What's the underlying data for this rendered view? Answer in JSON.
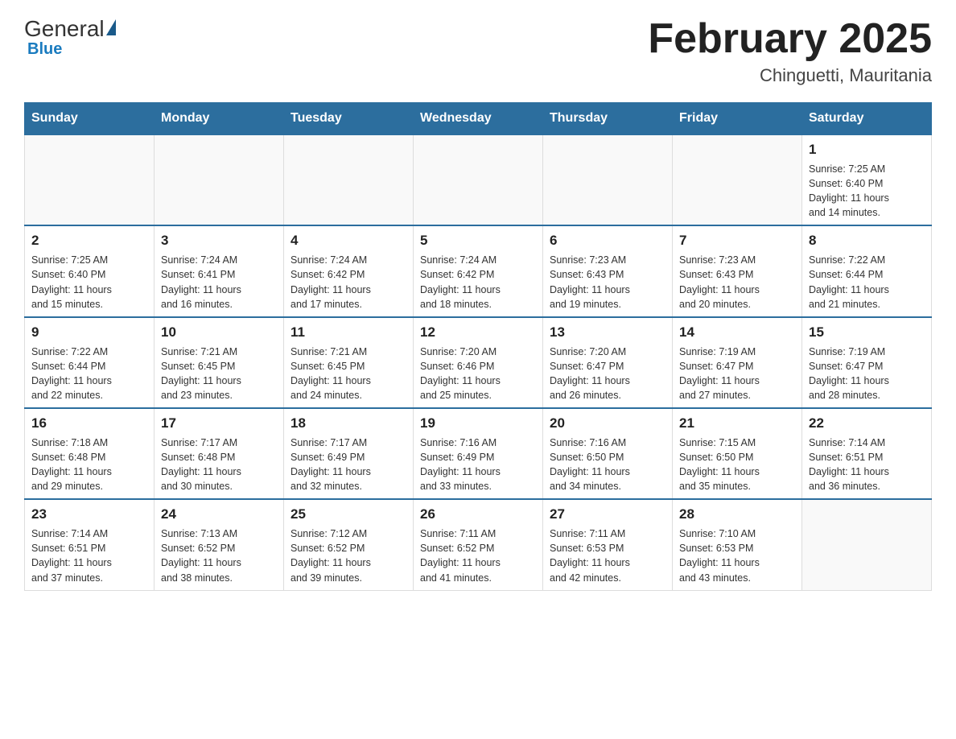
{
  "header": {
    "logo_general": "General",
    "logo_blue": "Blue",
    "calendar_title": "February 2025",
    "calendar_subtitle": "Chinguetti, Mauritania"
  },
  "days_of_week": [
    "Sunday",
    "Monday",
    "Tuesday",
    "Wednesday",
    "Thursday",
    "Friday",
    "Saturday"
  ],
  "weeks": [
    [
      {
        "day": "",
        "info": ""
      },
      {
        "day": "",
        "info": ""
      },
      {
        "day": "",
        "info": ""
      },
      {
        "day": "",
        "info": ""
      },
      {
        "day": "",
        "info": ""
      },
      {
        "day": "",
        "info": ""
      },
      {
        "day": "1",
        "info": "Sunrise: 7:25 AM\nSunset: 6:40 PM\nDaylight: 11 hours\nand 14 minutes."
      }
    ],
    [
      {
        "day": "2",
        "info": "Sunrise: 7:25 AM\nSunset: 6:40 PM\nDaylight: 11 hours\nand 15 minutes."
      },
      {
        "day": "3",
        "info": "Sunrise: 7:24 AM\nSunset: 6:41 PM\nDaylight: 11 hours\nand 16 minutes."
      },
      {
        "day": "4",
        "info": "Sunrise: 7:24 AM\nSunset: 6:42 PM\nDaylight: 11 hours\nand 17 minutes."
      },
      {
        "day": "5",
        "info": "Sunrise: 7:24 AM\nSunset: 6:42 PM\nDaylight: 11 hours\nand 18 minutes."
      },
      {
        "day": "6",
        "info": "Sunrise: 7:23 AM\nSunset: 6:43 PM\nDaylight: 11 hours\nand 19 minutes."
      },
      {
        "day": "7",
        "info": "Sunrise: 7:23 AM\nSunset: 6:43 PM\nDaylight: 11 hours\nand 20 minutes."
      },
      {
        "day": "8",
        "info": "Sunrise: 7:22 AM\nSunset: 6:44 PM\nDaylight: 11 hours\nand 21 minutes."
      }
    ],
    [
      {
        "day": "9",
        "info": "Sunrise: 7:22 AM\nSunset: 6:44 PM\nDaylight: 11 hours\nand 22 minutes."
      },
      {
        "day": "10",
        "info": "Sunrise: 7:21 AM\nSunset: 6:45 PM\nDaylight: 11 hours\nand 23 minutes."
      },
      {
        "day": "11",
        "info": "Sunrise: 7:21 AM\nSunset: 6:45 PM\nDaylight: 11 hours\nand 24 minutes."
      },
      {
        "day": "12",
        "info": "Sunrise: 7:20 AM\nSunset: 6:46 PM\nDaylight: 11 hours\nand 25 minutes."
      },
      {
        "day": "13",
        "info": "Sunrise: 7:20 AM\nSunset: 6:47 PM\nDaylight: 11 hours\nand 26 minutes."
      },
      {
        "day": "14",
        "info": "Sunrise: 7:19 AM\nSunset: 6:47 PM\nDaylight: 11 hours\nand 27 minutes."
      },
      {
        "day": "15",
        "info": "Sunrise: 7:19 AM\nSunset: 6:47 PM\nDaylight: 11 hours\nand 28 minutes."
      }
    ],
    [
      {
        "day": "16",
        "info": "Sunrise: 7:18 AM\nSunset: 6:48 PM\nDaylight: 11 hours\nand 29 minutes."
      },
      {
        "day": "17",
        "info": "Sunrise: 7:17 AM\nSunset: 6:48 PM\nDaylight: 11 hours\nand 30 minutes."
      },
      {
        "day": "18",
        "info": "Sunrise: 7:17 AM\nSunset: 6:49 PM\nDaylight: 11 hours\nand 32 minutes."
      },
      {
        "day": "19",
        "info": "Sunrise: 7:16 AM\nSunset: 6:49 PM\nDaylight: 11 hours\nand 33 minutes."
      },
      {
        "day": "20",
        "info": "Sunrise: 7:16 AM\nSunset: 6:50 PM\nDaylight: 11 hours\nand 34 minutes."
      },
      {
        "day": "21",
        "info": "Sunrise: 7:15 AM\nSunset: 6:50 PM\nDaylight: 11 hours\nand 35 minutes."
      },
      {
        "day": "22",
        "info": "Sunrise: 7:14 AM\nSunset: 6:51 PM\nDaylight: 11 hours\nand 36 minutes."
      }
    ],
    [
      {
        "day": "23",
        "info": "Sunrise: 7:14 AM\nSunset: 6:51 PM\nDaylight: 11 hours\nand 37 minutes."
      },
      {
        "day": "24",
        "info": "Sunrise: 7:13 AM\nSunset: 6:52 PM\nDaylight: 11 hours\nand 38 minutes."
      },
      {
        "day": "25",
        "info": "Sunrise: 7:12 AM\nSunset: 6:52 PM\nDaylight: 11 hours\nand 39 minutes."
      },
      {
        "day": "26",
        "info": "Sunrise: 7:11 AM\nSunset: 6:52 PM\nDaylight: 11 hours\nand 41 minutes."
      },
      {
        "day": "27",
        "info": "Sunrise: 7:11 AM\nSunset: 6:53 PM\nDaylight: 11 hours\nand 42 minutes."
      },
      {
        "day": "28",
        "info": "Sunrise: 7:10 AM\nSunset: 6:53 PM\nDaylight: 11 hours\nand 43 minutes."
      },
      {
        "day": "",
        "info": ""
      }
    ]
  ]
}
